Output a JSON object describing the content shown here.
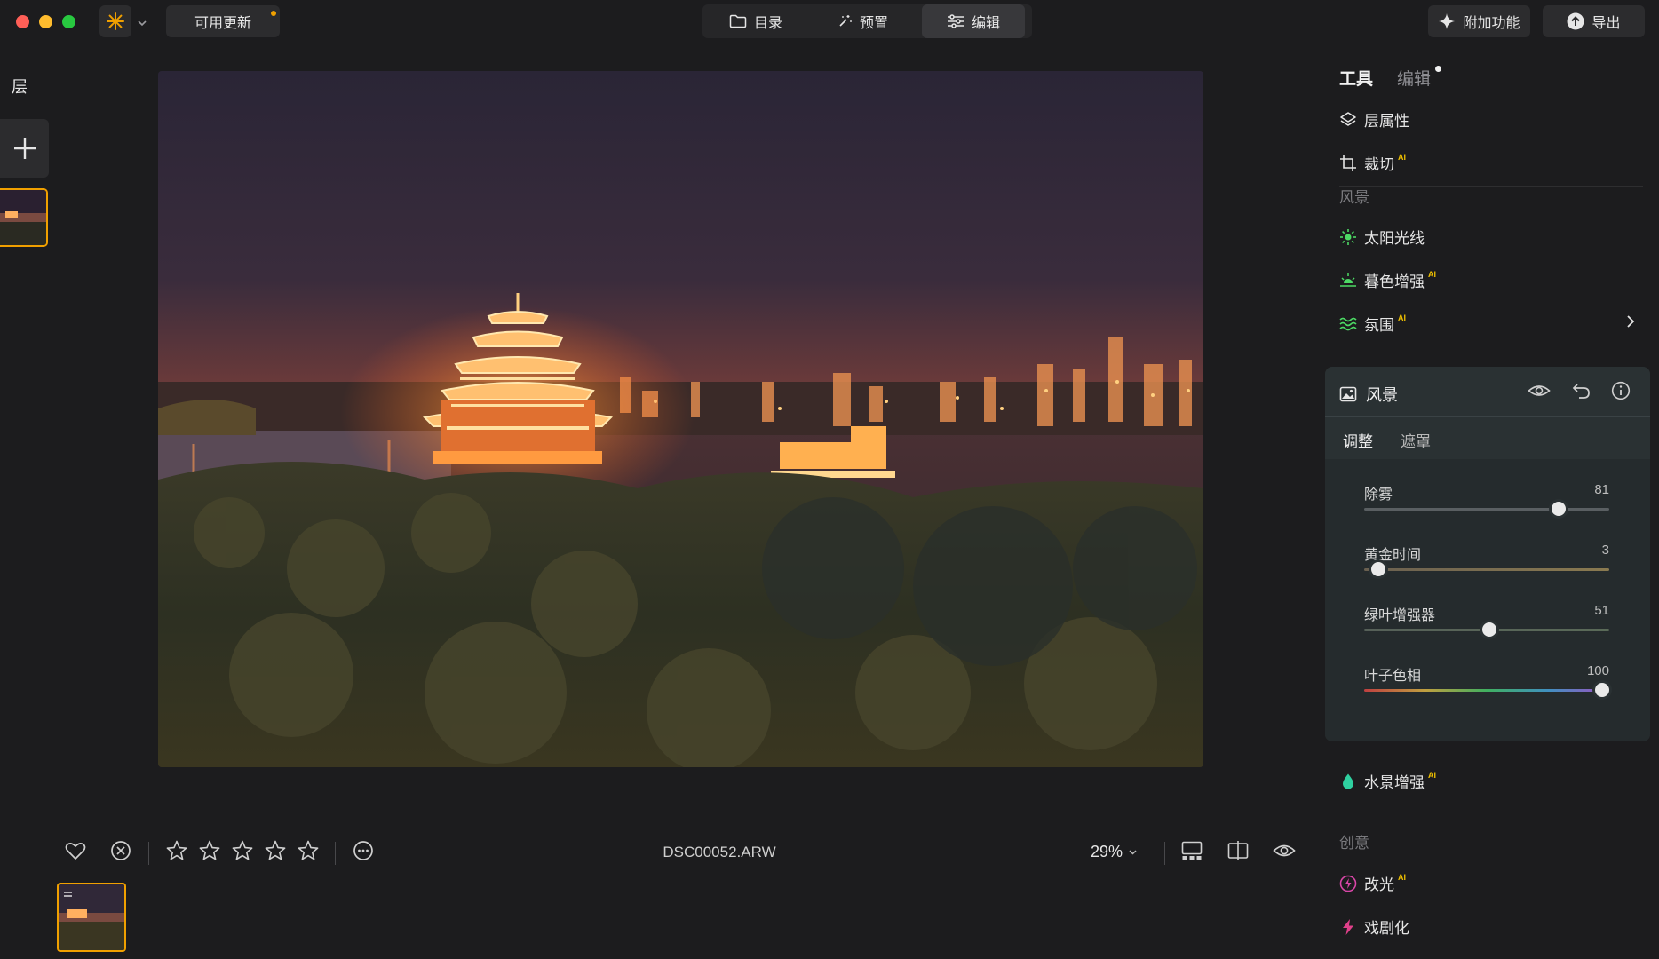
{
  "topbar": {
    "update_label": "可用更新",
    "tabs": [
      {
        "label": "目录",
        "icon": "folder-icon"
      },
      {
        "label": "预置",
        "icon": "wand-icon"
      },
      {
        "label": "编辑",
        "icon": "sliders-icon"
      }
    ],
    "addons_label": "附加功能",
    "export_label": "导出"
  },
  "left": {
    "layers_label": "层"
  },
  "bottom": {
    "filename": "DSC00052.ARW",
    "zoom": "29%",
    "rating_stars": 5
  },
  "right": {
    "tabs": {
      "tools": "工具",
      "edits": "编辑"
    },
    "tools": {
      "layer_props": "层属性",
      "crop": "裁切",
      "ai_badge": "AI"
    },
    "section_landscape": "风景",
    "landscape_tools": {
      "sunlight": "太阳光线",
      "golden": "暮色增强",
      "atmosphere": "氛围"
    },
    "card": {
      "title": "风景",
      "tab_adjust": "调整",
      "tab_mask": "遮罩",
      "sliders": [
        {
          "label": "除雾",
          "value": "81",
          "fraction": 0.81
        },
        {
          "label": "黄金时间",
          "value": "3",
          "fraction": 0.03
        },
        {
          "label": "绿叶增强器",
          "value": "51",
          "fraction": 0.51
        },
        {
          "label": "叶子色相",
          "value": "100",
          "fraction": 1.0
        }
      ]
    },
    "water": "水景增强",
    "section_creative": "创意",
    "creative_tools": {
      "relight": "改光",
      "dramatic": "戏剧化"
    }
  },
  "colors": {
    "accent_orange": "#f0a000",
    "ai_badge": "#f0c000",
    "sun_green": "#4cd964",
    "water_teal": "#2fd0a0",
    "relight_magenta": "#d946a8"
  }
}
